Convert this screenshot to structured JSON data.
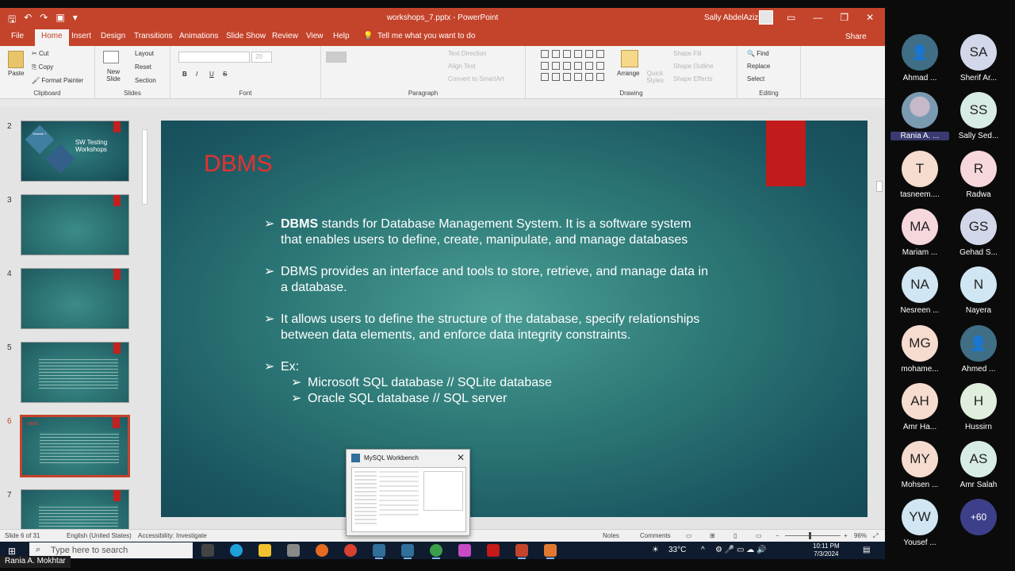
{
  "powerpoint": {
    "window_title": "workshops_7.pptx - PowerPoint",
    "user_name": "Sally AbdelAziz",
    "tabs": [
      "File",
      "Home",
      "Insert",
      "Design",
      "Transitions",
      "Animations",
      "Slide Show",
      "Review",
      "View",
      "Help"
    ],
    "active_tab": "Home",
    "tell_me": "Tell me what you want to do",
    "share_label": "Share",
    "ribbon": {
      "clipboard": {
        "label": "Clipboard",
        "paste": "Paste",
        "cut": "Cut",
        "copy": "Copy",
        "format_painter": "Format Painter"
      },
      "slides": {
        "label": "Slides",
        "new_slide": "New Slide",
        "layout": "Layout",
        "reset": "Reset",
        "section": "Section"
      },
      "font": {
        "label": "Font",
        "bold": "B",
        "italic": "I",
        "underline": "U",
        "strike": "S",
        "font_size": "20"
      },
      "paragraph": {
        "label": "Paragraph",
        "text_direction": "Text Direction",
        "align_text": "Align Text",
        "smartart": "Convert to SmartArt"
      },
      "drawing": {
        "label": "Drawing",
        "arrange": "Arrange",
        "quick_styles": "Quick Styles",
        "shape_fill": "Shape Fill",
        "shape_outline": "Shape Outline",
        "shape_effects": "Shape Effects"
      },
      "editing": {
        "label": "Editing",
        "find": "Find",
        "replace": "Replace",
        "select": "Select"
      }
    },
    "thumbnails": [
      {
        "num": "2",
        "title": "SW Testing Workshops",
        "subtitle": "Session 7"
      },
      {
        "num": "3",
        "title": ""
      },
      {
        "num": "4",
        "title": ""
      },
      {
        "num": "5",
        "title": ""
      },
      {
        "num": "6",
        "title": "DBMS"
      },
      {
        "num": "7",
        "title": ""
      }
    ],
    "selected_slide": "6",
    "slide": {
      "title": "DBMS",
      "bullets": [
        {
          "bold": "DBMS",
          "text": " stands for Database Management System. It is a software system that enables users to define, create, manipulate, and manage databases"
        },
        {
          "bold": "",
          "text": "DBMS provides an interface and tools to store, retrieve, and manage data in a database."
        },
        {
          "bold": "",
          "text": " It allows users to define the structure of the database, specify relationships between data elements, and enforce data integrity constraints."
        },
        {
          "bold": "",
          "text": "Ex:"
        }
      ],
      "sub_bullets": [
        "Microsoft SQL database // SQLite database",
        "Oracle SQL database   // SQL server"
      ]
    },
    "popup": {
      "title": "MySQL Workbench"
    },
    "statusbar": {
      "slide_count": "Slide 6 of 31",
      "language": "English (United States)",
      "accessibility": "Accessibility: Investigate",
      "notes": "Notes",
      "comments": "Comments",
      "zoom": "96%"
    }
  },
  "taskbar": {
    "search_placeholder": "Type here to search",
    "weather": "33°C",
    "time": "10:11 PM",
    "date": "7/3/2024"
  },
  "presenter_name": "Rania A. Mokhtar",
  "participants": [
    {
      "initials": "",
      "name": "Ahmad ...",
      "color": "#3f6e85",
      "icon": "user-icon"
    },
    {
      "initials": "SA",
      "name": "Sherif Ar...",
      "color": "#d3d7ea"
    },
    {
      "initials": "",
      "name": "Rania A. ...",
      "color": "#8aa3b8",
      "icon": "photo",
      "highlight": true
    },
    {
      "initials": "SS",
      "name": "Sally Sed...",
      "color": "#d7ece4"
    },
    {
      "initials": "T",
      "name": "tasneem....",
      "color": "#f6dccf"
    },
    {
      "initials": "R",
      "name": "Radwa",
      "color": "#f6d7dc"
    },
    {
      "initials": "MA",
      "name": "Mariam ...",
      "color": "#f6d7dc"
    },
    {
      "initials": "GS",
      "name": "Gehad S...",
      "color": "#d3d7ea"
    },
    {
      "initials": "NA",
      "name": "Nesreen ...",
      "color": "#d0e6f2"
    },
    {
      "initials": "N",
      "name": "Nayera",
      "color": "#d0e6f2"
    },
    {
      "initials": "MG",
      "name": "mohame...",
      "color": "#f6dccf"
    },
    {
      "initials": "",
      "name": "Ahmed ...",
      "color": "#3f6e85",
      "icon": "user-icon"
    },
    {
      "initials": "AH",
      "name": "Amr Ha...",
      "color": "#f6dccf"
    },
    {
      "initials": "H",
      "name": "Hussirn",
      "color": "#dfeedd"
    },
    {
      "initials": "MY",
      "name": "Mohsen ...",
      "color": "#f6dccf"
    },
    {
      "initials": "AS",
      "name": "Amr Salah",
      "color": "#d7ece4"
    },
    {
      "initials": "YW",
      "name": "Yousef ...",
      "color": "#d0e6f2"
    },
    {
      "initials": "+60",
      "name": "",
      "color": "#3d3f8a"
    }
  ]
}
